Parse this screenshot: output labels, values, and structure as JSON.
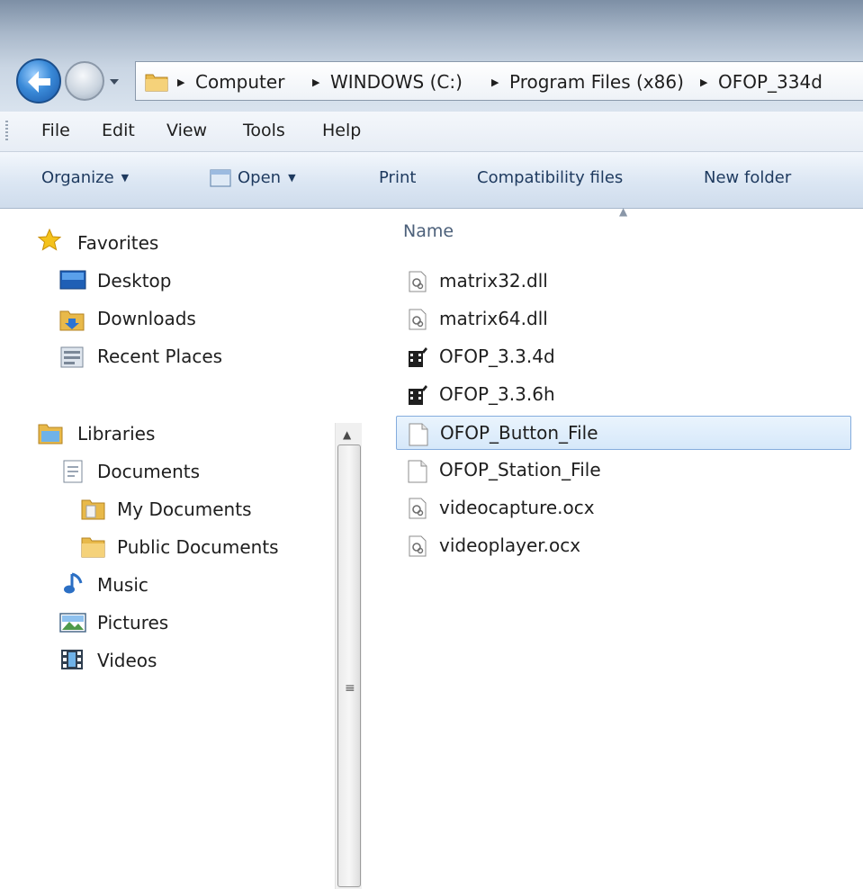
{
  "address": {
    "crumbs": [
      "Computer",
      "WINDOWS (C:)",
      "Program Files (x86)",
      "OFOP_334d"
    ]
  },
  "menu": {
    "items": [
      "File",
      "Edit",
      "View",
      "Tools",
      "Help"
    ]
  },
  "toolbar": {
    "organize": "Organize",
    "open": "Open",
    "print": "Print",
    "compatibility": "Compatibility files",
    "new_folder": "New folder"
  },
  "navigation": {
    "favorites": "Favorites",
    "desktop": "Desktop",
    "downloads": "Downloads",
    "recent_places": "Recent Places",
    "libraries": "Libraries",
    "documents": "Documents",
    "my_documents": "My Documents",
    "public_documents": "Public Documents",
    "music": "Music",
    "pictures": "Pictures",
    "videos": "Videos"
  },
  "file_list": {
    "column_name": "Name",
    "files": [
      {
        "name": "matrix32.dll",
        "icon": "dll-file-icon"
      },
      {
        "name": "matrix64.dll",
        "icon": "dll-file-icon"
      },
      {
        "name": "OFOP_3.3.4d",
        "icon": "application-icon"
      },
      {
        "name": "OFOP_3.3.6h",
        "icon": "application-icon"
      },
      {
        "name": "OFOP_Button_File",
        "icon": "blank-file-icon",
        "selected": true
      },
      {
        "name": "OFOP_Station_File",
        "icon": "blank-file-icon"
      },
      {
        "name": "videocapture.ocx",
        "icon": "ocx-file-icon"
      },
      {
        "name": "videoplayer.ocx",
        "icon": "ocx-file-icon"
      }
    ]
  },
  "colors": {
    "selection_fill": "#d6e8fa",
    "selection_border": "#84acdd",
    "toolbar_text": "#1e3a5f"
  }
}
